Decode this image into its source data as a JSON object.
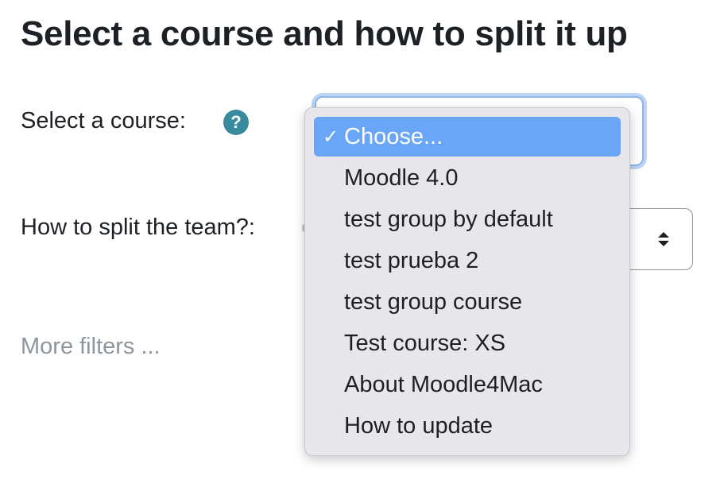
{
  "page": {
    "title": "Select a course and how to split it up"
  },
  "form": {
    "course_label": "Select a course:",
    "help_icon_glyph": "?",
    "split_label": "How to split the team?:",
    "more_filters": "More filters ..."
  },
  "course_dropdown": {
    "selected": "Choose...",
    "check_glyph": "✓",
    "options": [
      "Choose...",
      "Moodle 4.0",
      "test group by default",
      "test prueba 2",
      "test group course",
      "Test course: XS",
      "About Moodle4Mac",
      "How to update"
    ]
  },
  "icons": {
    "help": "question-circle-icon",
    "select_arrows": "up-down-chevron-icon",
    "check": "checkmark-icon"
  },
  "colors": {
    "help_icon": "#3a8a9f",
    "selected_option": "#6aa6f8",
    "focus_ring": "#bdd3f5",
    "muted_text": "#8f959e"
  }
}
